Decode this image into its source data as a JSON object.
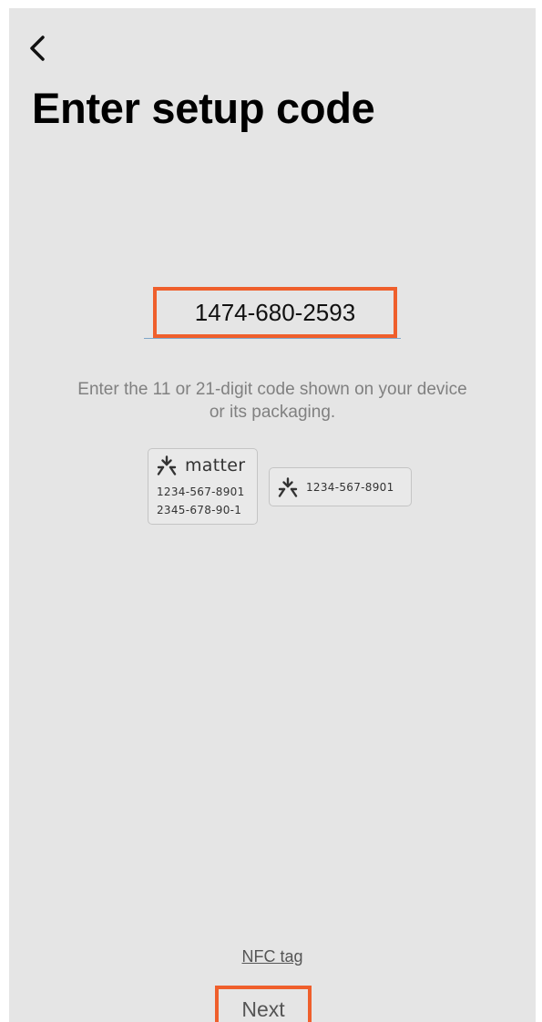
{
  "header": {
    "back_icon": "chevron-left-icon",
    "title": "Enter setup code"
  },
  "setup_code": {
    "value": "1474-680-2593",
    "highlight_color": "#ef5f2c",
    "underline_color": "#7ea6c9"
  },
  "helper_text": {
    "line1": "Enter the 11 or 21-digit code shown on your device",
    "line2": "or its packaging."
  },
  "examples": {
    "qr_label": {
      "icon": "matter-logo-icon",
      "brand": "matter",
      "code_11": "1234-567-8901",
      "code_21": "2345-678-90-1"
    },
    "short_label": {
      "icon": "matter-logo-icon",
      "code": "1234-567-8901"
    }
  },
  "footer": {
    "nfc_label": "NFC tag",
    "next_label": "Next"
  },
  "colors": {
    "background": "#e5e5e5",
    "accent_outline": "#ef5f2c"
  }
}
